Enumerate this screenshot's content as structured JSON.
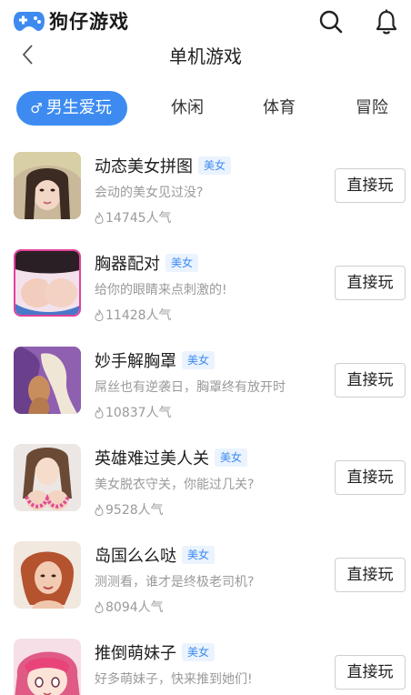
{
  "app": {
    "name": "狗仔游戏",
    "brand_color": "#3d8bf0"
  },
  "header": {
    "title": "单机游戏",
    "icons": [
      "gamepad-logo-icon",
      "search-icon",
      "bell-icon",
      "back-arrow-icon"
    ]
  },
  "tabs": [
    {
      "label": "男生爱玩",
      "icon": "male-symbol-icon",
      "active": true
    },
    {
      "label": "休闲",
      "active": false
    },
    {
      "label": "体育",
      "active": false
    },
    {
      "label": "冒险",
      "active": false
    }
  ],
  "games": [
    {
      "name": "动态美女拼图",
      "tag": "美女",
      "description": "会动的美女见过没?",
      "popularity": "14745人气",
      "button": "直接玩"
    },
    {
      "name": "胸器配对",
      "tag": "美女",
      "description": "给你的眼睛来点刺激的!",
      "popularity": "11428人气",
      "button": "直接玩"
    },
    {
      "name": "妙手解胸罩",
      "tag": "美女",
      "description": "屌丝也有逆袭日，胸罩终有放开时",
      "popularity": "10837人气",
      "button": "直接玩"
    },
    {
      "name": "英雄难过美人关",
      "tag": "美女",
      "description": "美女脱衣守关，你能过几关?",
      "popularity": "9528人气",
      "button": "直接玩"
    },
    {
      "name": "岛国么么哒",
      "tag": "美女",
      "description": "测测看，谁才是终极老司机?",
      "popularity": "8094人气",
      "button": "直接玩"
    },
    {
      "name": "推倒萌妹子",
      "tag": "美女",
      "description": "好多萌妹子，快来推到她们!",
      "popularity": "",
      "button": "直接玩"
    }
  ]
}
